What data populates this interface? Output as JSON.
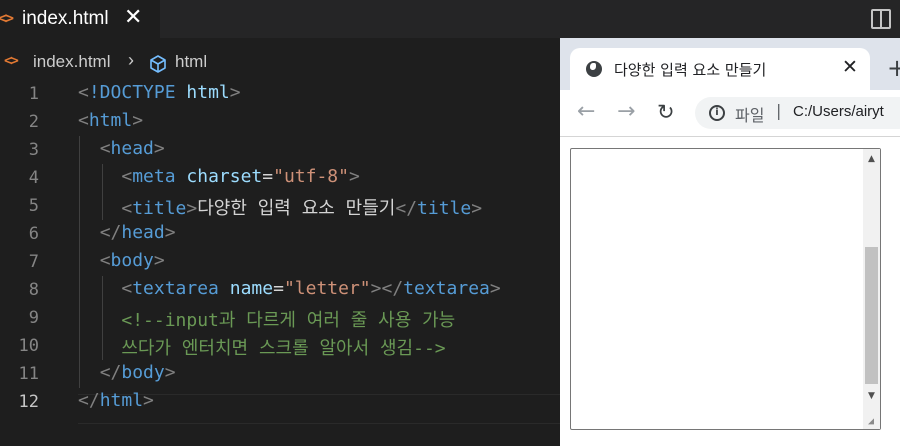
{
  "editor": {
    "tab": {
      "icon": "html-file-icon",
      "icon_glyph": "<>",
      "filename": "index.html",
      "close_glyph": "✕"
    },
    "breadcrumb": {
      "file": "index.html",
      "separator": "›",
      "element_icon": "cube-icon",
      "element": "html"
    },
    "lines": [
      {
        "n": "1",
        "tokens": [
          [
            "punc",
            "<"
          ],
          [
            "tag",
            "!DOCTYPE"
          ],
          [
            "text",
            " "
          ],
          [
            "attr",
            "html"
          ],
          [
            "punc",
            ">"
          ]
        ]
      },
      {
        "n": "2",
        "tokens": [
          [
            "punc",
            "<"
          ],
          [
            "tag",
            "html"
          ],
          [
            "punc",
            ">"
          ]
        ]
      },
      {
        "n": "3",
        "tokens": [
          [
            "text",
            "  "
          ],
          [
            "punc",
            "<"
          ],
          [
            "tag",
            "head"
          ],
          [
            "punc",
            ">"
          ]
        ]
      },
      {
        "n": "4",
        "tokens": [
          [
            "text",
            "    "
          ],
          [
            "punc",
            "<"
          ],
          [
            "tag",
            "meta"
          ],
          [
            "text",
            " "
          ],
          [
            "attr",
            "charset"
          ],
          [
            "text",
            "="
          ],
          [
            "str",
            "\"utf-8\""
          ],
          [
            "punc",
            ">"
          ]
        ]
      },
      {
        "n": "5",
        "tokens": [
          [
            "text",
            "    "
          ],
          [
            "punc",
            "<"
          ],
          [
            "tag",
            "title"
          ],
          [
            "punc",
            ">"
          ],
          [
            "text",
            "다양한 입력 요소 만들기"
          ],
          [
            "punc",
            "</"
          ],
          [
            "tag",
            "title"
          ],
          [
            "punc",
            ">"
          ]
        ]
      },
      {
        "n": "6",
        "tokens": [
          [
            "text",
            "  "
          ],
          [
            "punc",
            "</"
          ],
          [
            "tag",
            "head"
          ],
          [
            "punc",
            ">"
          ]
        ]
      },
      {
        "n": "7",
        "tokens": [
          [
            "text",
            "  "
          ],
          [
            "punc",
            "<"
          ],
          [
            "tag",
            "body"
          ],
          [
            "punc",
            ">"
          ]
        ]
      },
      {
        "n": "8",
        "tokens": [
          [
            "text",
            "    "
          ],
          [
            "punc",
            "<"
          ],
          [
            "tag",
            "textarea"
          ],
          [
            "text",
            " "
          ],
          [
            "attr",
            "name"
          ],
          [
            "text",
            "="
          ],
          [
            "str",
            "\"letter\""
          ],
          [
            "punc",
            "></"
          ],
          [
            "tag",
            "textarea"
          ],
          [
            "punc",
            ">"
          ]
        ]
      },
      {
        "n": "9",
        "tokens": [
          [
            "text",
            "    "
          ],
          [
            "com",
            "<!--input과 다르게 여러 줄 사용 가능"
          ]
        ]
      },
      {
        "n": "10",
        "tokens": [
          [
            "text",
            "    "
          ],
          [
            "com",
            "쓰다가 엔터치면 스크롤 알아서 생김-->"
          ]
        ]
      },
      {
        "n": "11",
        "tokens": [
          [
            "text",
            "  "
          ],
          [
            "punc",
            "</"
          ],
          [
            "tag",
            "body"
          ],
          [
            "punc",
            ">"
          ]
        ]
      },
      {
        "n": "12",
        "tokens": [
          [
            "punc",
            "</"
          ],
          [
            "tag",
            "html"
          ],
          [
            "punc",
            ">"
          ]
        ]
      }
    ],
    "active_line": "12"
  },
  "browser": {
    "tab_title": "다양한 입력 요소 만들기",
    "tab_close": "✕",
    "new_tab": "+",
    "back": "←",
    "forward": "→",
    "reload": "↻",
    "address_label": "파일",
    "address_sep": "|",
    "url": "C:/Users/airyt"
  },
  "colors": {
    "editor_bg": "#1e1e1e",
    "tag": "#569cd6",
    "attr": "#9cdcfe",
    "string": "#ce9178",
    "comment": "#6a9955",
    "punct": "#808080",
    "html_icon": "#e37933"
  }
}
